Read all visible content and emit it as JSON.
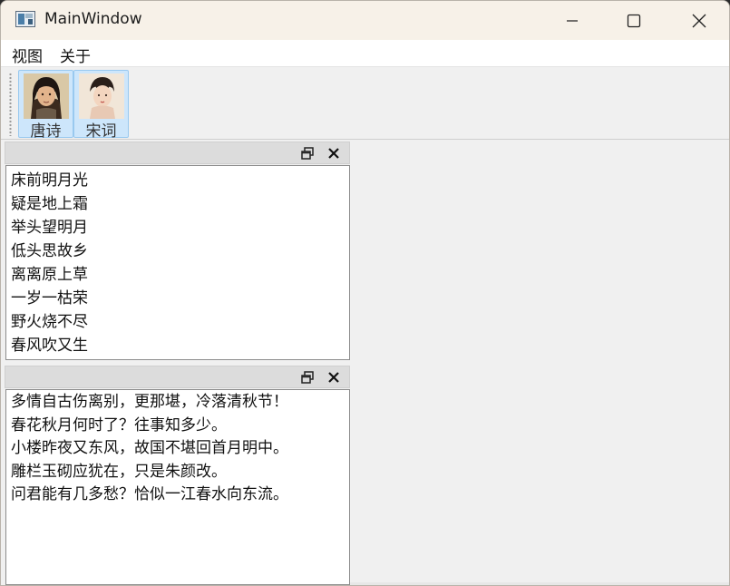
{
  "window": {
    "title": "MainWindow",
    "app_icon": "app-window-icon"
  },
  "caption_buttons": {
    "minimize": "minimize-icon",
    "maximize": "maximize-icon",
    "close": "close-icon"
  },
  "menubar": {
    "items": [
      {
        "label": "视图"
      },
      {
        "label": "关于"
      }
    ]
  },
  "toolbar": {
    "buttons": [
      {
        "label": "唐诗",
        "icon": "male-poet-portrait-icon",
        "checked": true
      },
      {
        "label": "宋词",
        "icon": "female-poet-portrait-icon",
        "checked": true
      }
    ]
  },
  "docks": [
    {
      "title": "",
      "lines": [
        "床前明月光",
        "疑是地上霜",
        "举头望明月",
        "低头思故乡",
        "离离原上草",
        "一岁一枯荣",
        "野火烧不尽",
        "春风吹又生"
      ]
    },
    {
      "title": "",
      "lines": [
        "多情自古伤离别，更那堪，冷落清秋节！",
        "春花秋月何时了？往事知多少。",
        "小楼昨夜又东风，故国不堪回首月明中。",
        "雕栏玉砌应犹在，只是朱颜改。",
        "问君能有几多愁？恰似一江春水向东流。"
      ]
    }
  ],
  "colors": {
    "title_bar": "#f7f1e8",
    "toolbar_checked": "#cde6fb",
    "dock_title": "#dcdcdc"
  }
}
